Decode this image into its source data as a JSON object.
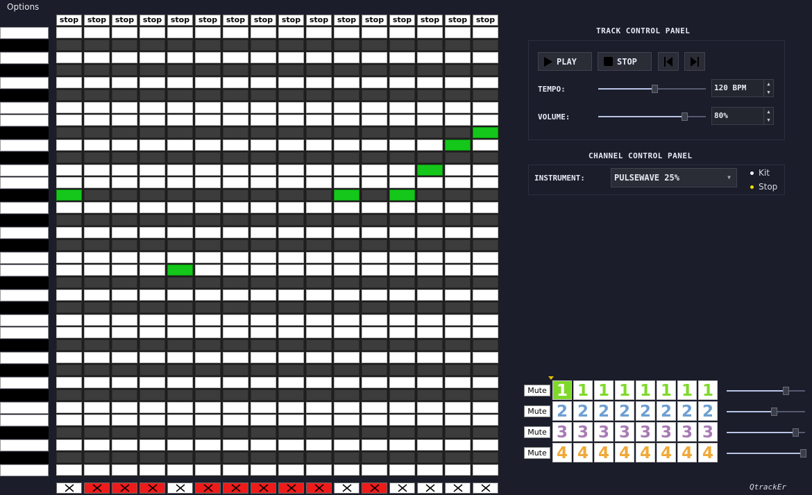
{
  "menu": {
    "options_label": "Options"
  },
  "grid": {
    "columns": 16,
    "rows": 36,
    "stop_label": "stop",
    "piano_pattern": [
      "w",
      "b",
      "w",
      "b",
      "w",
      "b",
      "w",
      "w",
      "b",
      "w",
      "b",
      "w",
      "w",
      "b",
      "w",
      "b",
      "w",
      "b",
      "w",
      "w",
      "b",
      "w",
      "b",
      "w",
      "w",
      "b",
      "w",
      "b",
      "w",
      "b",
      "w",
      "w",
      "b",
      "w",
      "b",
      "w"
    ],
    "active_cells": [
      {
        "col": 15,
        "row": 8
      },
      {
        "col": 14,
        "row": 9
      },
      {
        "col": 13,
        "row": 11
      },
      {
        "col": 0,
        "row": 13
      },
      {
        "col": 10,
        "row": 13
      },
      {
        "col": 12,
        "row": 13
      },
      {
        "col": 4,
        "row": 19
      }
    ],
    "column_mute": [
      false,
      true,
      true,
      true,
      false,
      true,
      true,
      true,
      true,
      true,
      false,
      true,
      false,
      false,
      false,
      false
    ]
  },
  "track_panel": {
    "title": "TRACK CONTROL PANEL",
    "play_label": "PLAY",
    "stop_label": "STOP",
    "tempo_label": "TEMPO:",
    "tempo_value": "120 BPM",
    "tempo_level": 0.52,
    "volume_label": "VOLUME:",
    "volume_value": "80%",
    "volume_level": 0.8
  },
  "channel_panel": {
    "title": "CHANNEL CONTROL PANEL",
    "instrument_label": "INSTRUMENT:",
    "instrument_value": "PULSEWAVE 25%",
    "radio_options": [
      {
        "label": "Kit",
        "color": "#ffffff"
      },
      {
        "label": "Stop",
        "color": "#f0e000"
      }
    ]
  },
  "channels": [
    {
      "mute_label": "Mute",
      "number": "1",
      "color": "#7fd92a",
      "volume_level": 0.75
    },
    {
      "mute_label": "Mute",
      "number": "2",
      "color": "#6d9fd2",
      "volume_level": 0.6
    },
    {
      "mute_label": "Mute",
      "number": "3",
      "color": "#a97ab5",
      "volume_level": 0.88
    },
    {
      "mute_label": "Mute",
      "number": "4",
      "color": "#f0a93a",
      "volume_level": 0.97
    }
  ],
  "steps_per_channel": 8,
  "brand": "QtrackEr"
}
